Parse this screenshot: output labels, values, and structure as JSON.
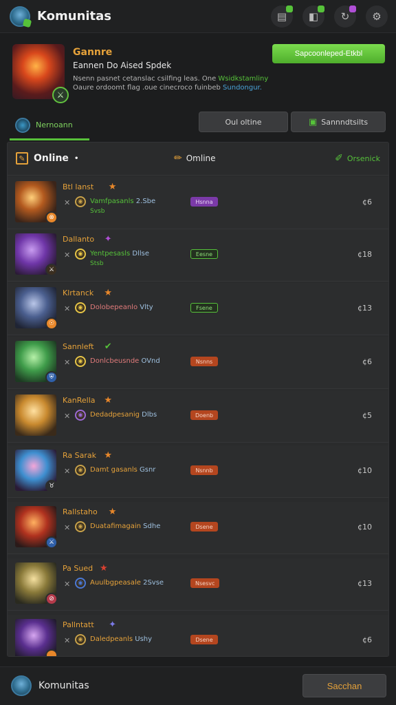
{
  "app": {
    "title": "Komunitas"
  },
  "top_icons": [
    {
      "name": "cake-icon",
      "glyph": "▤",
      "dot": "#56c23a"
    },
    {
      "name": "gift-icon",
      "glyph": "◧",
      "dot": "#56c23a"
    },
    {
      "name": "refresh-icon",
      "glyph": "↻",
      "dot": "#b04fd6"
    },
    {
      "name": "gear-icon",
      "glyph": "⚙",
      "dot": ""
    }
  ],
  "game": {
    "name": "Gannre",
    "subtitle": "Eannen Do Aised Spdek",
    "desc_line1": "Nsenn pasnet cetanslac csilfing leas. One",
    "desc_line1_hl": "Wsidkstamliny",
    "desc_line2": "Oaure ordoomt flag .oue cinecroco fuinbeb",
    "desc_line2_hl": "Sundongur.",
    "support_label": "Sapcoonleped-Etkbl"
  },
  "tabs": {
    "main_label": "Nernoann",
    "offline_label": "Oul oltine",
    "stats_label": "Sannndtsilts"
  },
  "list_header": {
    "left_label": "Online",
    "left_suffix": "•",
    "mid_label": "Omline",
    "right_label": "Orsenick"
  },
  "rows": [
    {
      "name": "Btl lanst",
      "rank_glyph": "★",
      "rank_color": "#e8872a",
      "stat_a": "Vamfpasanls",
      "stat_b": "2.Sbe",
      "stat_a_color": "#56c23a",
      "sub": "Svsb",
      "sub_color": "#56c23a",
      "tag": "Hsnna",
      "tag_bg": "#7b3aa8",
      "tag_fg": "#e8d8f5",
      "tag_border": "#7b3aa8",
      "count": "¢6",
      "coin": "◉",
      "coin_color": "#c8a24a",
      "badge": "⊗",
      "badge_bg": "#e8872a",
      "art": "radial-gradient(circle at 40% 40%, #ffcf7a 0%, #b35a1f 35%, #3a2419 75%)"
    },
    {
      "name": "Dallanto",
      "rank_glyph": "✦",
      "rank_color": "#b04fd6",
      "stat_a": "Yentpesasls",
      "stat_b": "Dllse",
      "stat_a_color": "#56c23a",
      "sub": "Stsb",
      "sub_color": "#56c23a",
      "tag": "Eesne",
      "tag_bg": "#23301f",
      "tag_fg": "#8fe07a",
      "tag_border": "#56c23a",
      "count": "¢18",
      "coin": "◉",
      "coin_color": "#e6c547",
      "badge": "⚔",
      "badge_bg": "#3a2e20",
      "art": "radial-gradient(circle at 40% 40%, #c89cf0 0%, #6f36a8 40%, #2a1a35 80%)"
    },
    {
      "name": "Klrtanck",
      "rank_glyph": "★",
      "rank_color": "#e8872a",
      "stat_a": "Dolobepeanlo",
      "stat_b": "Vlty",
      "stat_a_color": "#e17b7b",
      "sub": "",
      "sub_color": "#56c23a",
      "tag": "Fsene",
      "tag_bg": "#23301f",
      "tag_fg": "#8fe07a",
      "tag_border": "#56c23a",
      "count": "¢13",
      "coin": "◉",
      "coin_color": "#e6c547",
      "badge": "☉",
      "badge_bg": "#e8872a",
      "art": "radial-gradient(circle at 45% 40%, #b9c6e8 0%, #4b5f8f 40%, #1f2434 80%)"
    },
    {
      "name": "Sannleft",
      "rank_glyph": "✔",
      "rank_color": "#56c23a",
      "stat_a": "Donlcbeusnde",
      "stat_b": "OVnd",
      "stat_a_color": "#e17b7b",
      "sub": "",
      "sub_color": "#56c23a",
      "tag": "Nsnns",
      "tag_bg": "#b4461f",
      "tag_fg": "#f5d4c5",
      "tag_border": "#b4461f",
      "count": "¢6",
      "coin": "◉",
      "coin_color": "#e6c547",
      "badge": "⛨",
      "badge_bg": "#2f5fa8",
      "art": "radial-gradient(circle at 45% 40%, #b6f0a8 0%, #3f9c4a 40%, #1d3a22 80%)"
    },
    {
      "name": "KanRella",
      "rank_glyph": "★",
      "rank_color": "#e8872a",
      "stat_a": "Dedadpesanig",
      "stat_b": "Dlbs",
      "stat_a_color": "#e6a23a",
      "sub": "",
      "sub_color": "#56c23a",
      "tag": "Doenb",
      "tag_bg": "#b4461f",
      "tag_fg": "#f5d4c5",
      "tag_border": "#b4461f",
      "count": "¢5",
      "coin": "◉",
      "coin_color": "#9b6ad6",
      "badge": "",
      "badge_bg": "",
      "art": "radial-gradient(circle at 45% 40%, #ffe0a0 0%, #c98a2f 40%, #3a2a1a 80%)"
    },
    {
      "name": "Ra Sarak",
      "rank_glyph": "★",
      "rank_color": "#e8872a",
      "stat_a": "Damt gasanls",
      "stat_b": "Gsnr",
      "stat_a_color": "#e6a23a",
      "sub": "",
      "sub_color": "#56c23a",
      "tag": "Nsnnb",
      "tag_bg": "#b4461f",
      "tag_fg": "#f5d4c5",
      "tag_border": "#b4461f",
      "count": "¢10",
      "coin": "◉",
      "coin_color": "#c8a24a",
      "badge": "♉",
      "badge_bg": "#2c2d2e",
      "art": "radial-gradient(circle at 45% 40%, #f5a6d8 0%, #3e8fd0 40%, #2a1a35 80%)"
    },
    {
      "name": "Rallstaho",
      "rank_glyph": "★",
      "rank_color": "#e8872a",
      "stat_a": "Duatafimagain",
      "stat_b": "Sdhe",
      "stat_a_color": "#e6a23a",
      "sub": "",
      "sub_color": "#56c23a",
      "tag": "Dsene",
      "tag_bg": "#b4461f",
      "tag_fg": "#f5d4c5",
      "tag_border": "#b4461f",
      "count": "¢10",
      "coin": "◉",
      "coin_color": "#c8a24a",
      "badge": "⚔",
      "badge_bg": "#2f5fa8",
      "art": "radial-gradient(circle at 45% 40%, #ffb060 0%, #b0321f 40%, #2a1a19 80%)"
    },
    {
      "name": "Pa Sued",
      "rank_glyph": "★",
      "rank_color": "#d94030",
      "stat_a": "Auulbgpeasale",
      "stat_b": "2Svse",
      "stat_a_color": "#e6a23a",
      "sub": "",
      "sub_color": "#56c23a",
      "tag": "Nsesvc",
      "tag_bg": "#b4461f",
      "tag_fg": "#f5d4c5",
      "tag_border": "#b4461f",
      "count": "¢13",
      "coin": "◉",
      "coin_color": "#4a78d6",
      "badge": "⊘",
      "badge_bg": "#b43a4a",
      "art": "radial-gradient(circle at 45% 40%, #f5e0a0 0%, #8a7a3a 40%, #2a2a1f 80%)"
    },
    {
      "name": "Pallntatt",
      "rank_glyph": "✦",
      "rank_color": "#7a7ae8",
      "stat_a": "Daledpeanls",
      "stat_b": "Ushy",
      "stat_a_color": "#e6a23a",
      "sub": "",
      "sub_color": "#56c23a",
      "tag": "Dsene",
      "tag_bg": "#b4461f",
      "tag_fg": "#f5d4c5",
      "tag_border": "#b4461f",
      "count": "¢6",
      "coin": "◉",
      "coin_color": "#c8a24a",
      "badge": "",
      "badge_bg": "#e8872a",
      "art": "radial-gradient(circle at 45% 40%, #d6a6f0 0%, #5a2f8f 40%, #1f1a2a 80%)"
    }
  ],
  "bottom": {
    "title": "Komunitas",
    "search_label": "Sacchan"
  }
}
